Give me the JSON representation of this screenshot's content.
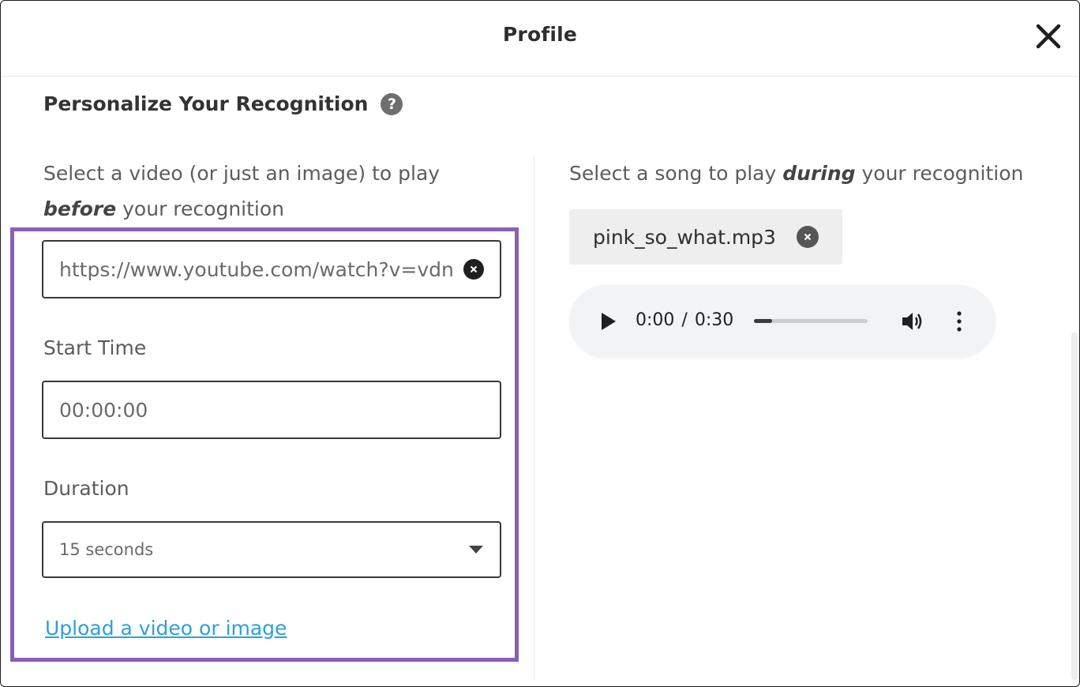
{
  "header": {
    "title": "Profile"
  },
  "section": {
    "title": "Personalize Your Recognition"
  },
  "video": {
    "desc_before": "Select a video (or just an image) to play ",
    "desc_em": "before",
    "desc_after": " your recognition",
    "url_value": "https://www.youtube.com/watch?v=vdn",
    "start_label": "Start Time",
    "start_value": "00:00:00",
    "duration_label": "Duration",
    "duration_value": "15 seconds",
    "upload_link": "Upload a video or image"
  },
  "song": {
    "desc_before": "Select a song to play ",
    "desc_em": "during",
    "desc_after": " your recognition",
    "file_name": "pink_so_what.mp3"
  },
  "player": {
    "current_time": "0:00",
    "separator": "/",
    "total_time": "0:30",
    "progress_fraction": 0.16
  },
  "colors": {
    "highlight_border": "#8b5fb3",
    "link": "#2f9fd8"
  },
  "icons": {
    "close": "close-icon",
    "help": "help-icon",
    "clear": "clear-icon",
    "dropdown": "chevron-down-icon",
    "play": "play-icon",
    "volume": "volume-icon",
    "more": "more-vertical-icon"
  }
}
